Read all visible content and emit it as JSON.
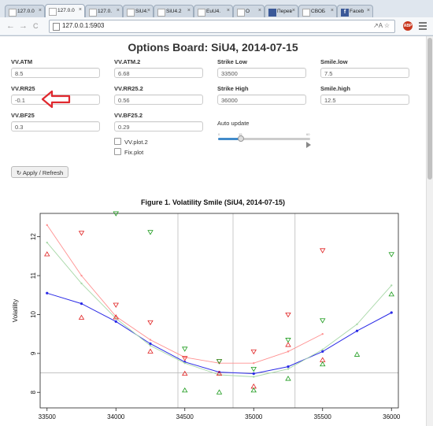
{
  "browser": {
    "tabs": [
      {
        "title": "127.0.0",
        "icon": "page-icon"
      },
      {
        "title": "127.0.0",
        "icon": "page-icon"
      },
      {
        "title": "127.0.",
        "icon": "page-icon"
      },
      {
        "title": "SiU4.",
        "icon": "page-icon"
      },
      {
        "title": "SiU4.2",
        "icon": "page-icon"
      },
      {
        "title": "EuU4.",
        "icon": "page-icon"
      },
      {
        "title": "O",
        "icon": "page-icon"
      },
      {
        "title": "Перев",
        "icon": "translate-icon"
      },
      {
        "title": "СВОБ",
        "icon": "page-icon"
      },
      {
        "title": "Faceb",
        "icon": "facebook-icon"
      }
    ],
    "url": "127.0.0.1:5903",
    "translate_glyph": "↗A",
    "star_glyph": "☆",
    "ext_label": "ABP",
    "back_glyph": "←",
    "forward_glyph": "→",
    "reload_glyph": "C"
  },
  "app": {
    "title": "Options Board: SiU4, 2014-07-15",
    "fields": {
      "vv_atm": {
        "label": "VV.ATM",
        "value": "8.5"
      },
      "vv_rr25": {
        "label": "VV.RR25",
        "value": "-0.1"
      },
      "vv_bf25": {
        "label": "VV.BF25",
        "value": "0.3"
      },
      "vv_atm2": {
        "label": "VV.ATM.2",
        "value": "6.68"
      },
      "vv_rr252": {
        "label": "VV.RR25.2",
        "value": "0.56"
      },
      "vv_bf252": {
        "label": "VV.BF25.2",
        "value": "0.29"
      },
      "strike_low": {
        "label": "Strike Low",
        "value": "33500"
      },
      "strike_high": {
        "label": "Strike High",
        "value": "36000"
      },
      "smile_low": {
        "label": "Smile.low",
        "value": "7.5"
      },
      "smile_high": {
        "label": "Smile.high",
        "value": "12.5"
      }
    },
    "checkboxes": {
      "vv_plot2": "VV.plot.2",
      "fix_plot": "Fix.plot"
    },
    "auto_update": {
      "label": "Auto update",
      "min": "0",
      "value": "15",
      "max": "60",
      "level": 0.25
    },
    "apply_button": "Apply / Refresh",
    "apply_icon": "↻",
    "annotation_color": "#e0282e"
  },
  "chart_data": {
    "type": "scatter",
    "title": "Figure 1. Volatility Smile (SiU4, 2014-07-15)",
    "xlabel": "",
    "ylabel": "Volatility",
    "xlim": [
      33450,
      36050
    ],
    "ylim": [
      7.6,
      12.6
    ],
    "x_ticks": [
      "33500",
      "34000",
      "34500",
      "35000",
      "35500",
      "36000"
    ],
    "y_ticks": [
      "8",
      "9",
      "10",
      "11",
      "12"
    ],
    "hline": 8.5,
    "vlines": [
      34450,
      34850,
      35300
    ],
    "series": [
      {
        "color": "#2a2ae6",
        "kind": "line",
        "points": [
          [
            33500,
            10.55
          ],
          [
            33750,
            10.28
          ],
          [
            34000,
            9.82
          ],
          [
            34250,
            9.25
          ],
          [
            34500,
            8.78
          ],
          [
            34750,
            8.52
          ],
          [
            35000,
            8.48
          ],
          [
            35250,
            8.66
          ],
          [
            35500,
            9.05
          ],
          [
            35750,
            9.58
          ],
          [
            36000,
            10.05
          ]
        ]
      },
      {
        "color": "#ff9090",
        "kind": "line",
        "points": [
          [
            33500,
            12.3
          ],
          [
            33750,
            11.0
          ],
          [
            34000,
            9.95
          ],
          [
            34250,
            9.35
          ],
          [
            34500,
            8.9
          ],
          [
            34750,
            8.75
          ],
          [
            35000,
            8.75
          ],
          [
            35250,
            9.05
          ],
          [
            35500,
            9.5
          ]
        ]
      },
      {
        "color": "#a8d8a8",
        "kind": "line",
        "points": [
          [
            33500,
            11.85
          ],
          [
            33750,
            10.8
          ],
          [
            34000,
            9.9
          ],
          [
            34250,
            9.2
          ],
          [
            34500,
            8.75
          ],
          [
            34750,
            8.45
          ],
          [
            35000,
            8.4
          ],
          [
            35250,
            8.6
          ],
          [
            35500,
            9.1
          ],
          [
            35750,
            9.75
          ],
          [
            36000,
            10.75
          ]
        ]
      },
      {
        "color": "#e02020",
        "kind": "tri-up",
        "points": [
          [
            33500,
            11.55
          ],
          [
            33750,
            9.92
          ],
          [
            34000,
            9.93
          ],
          [
            34250,
            9.05
          ],
          [
            34500,
            8.48
          ],
          [
            34750,
            8.48
          ],
          [
            35000,
            8.15
          ],
          [
            35250,
            9.22
          ],
          [
            35500,
            8.83
          ]
        ]
      },
      {
        "color": "#e02020",
        "kind": "tri-down",
        "points": [
          [
            33750,
            12.1
          ],
          [
            34000,
            10.25
          ],
          [
            34250,
            9.8
          ],
          [
            34500,
            8.88
          ],
          [
            34750,
            8.8
          ],
          [
            35000,
            9.05
          ],
          [
            35250,
            10.0
          ],
          [
            35500,
            11.65
          ]
        ]
      },
      {
        "color": "#1a9a1a",
        "kind": "tri-up",
        "points": [
          [
            34500,
            8.05
          ],
          [
            34750,
            8.0
          ],
          [
            35000,
            8.05
          ],
          [
            35250,
            8.35
          ],
          [
            35500,
            8.72
          ],
          [
            35750,
            8.97
          ],
          [
            36000,
            10.52
          ]
        ]
      },
      {
        "color": "#1a9a1a",
        "kind": "tri-down",
        "points": [
          [
            34000,
            12.6
          ],
          [
            34250,
            12.12
          ],
          [
            34500,
            9.12
          ],
          [
            34750,
            8.8
          ],
          [
            35000,
            8.6
          ],
          [
            35250,
            9.35
          ],
          [
            35500,
            9.85
          ],
          [
            36000,
            11.55
          ]
        ]
      }
    ]
  }
}
